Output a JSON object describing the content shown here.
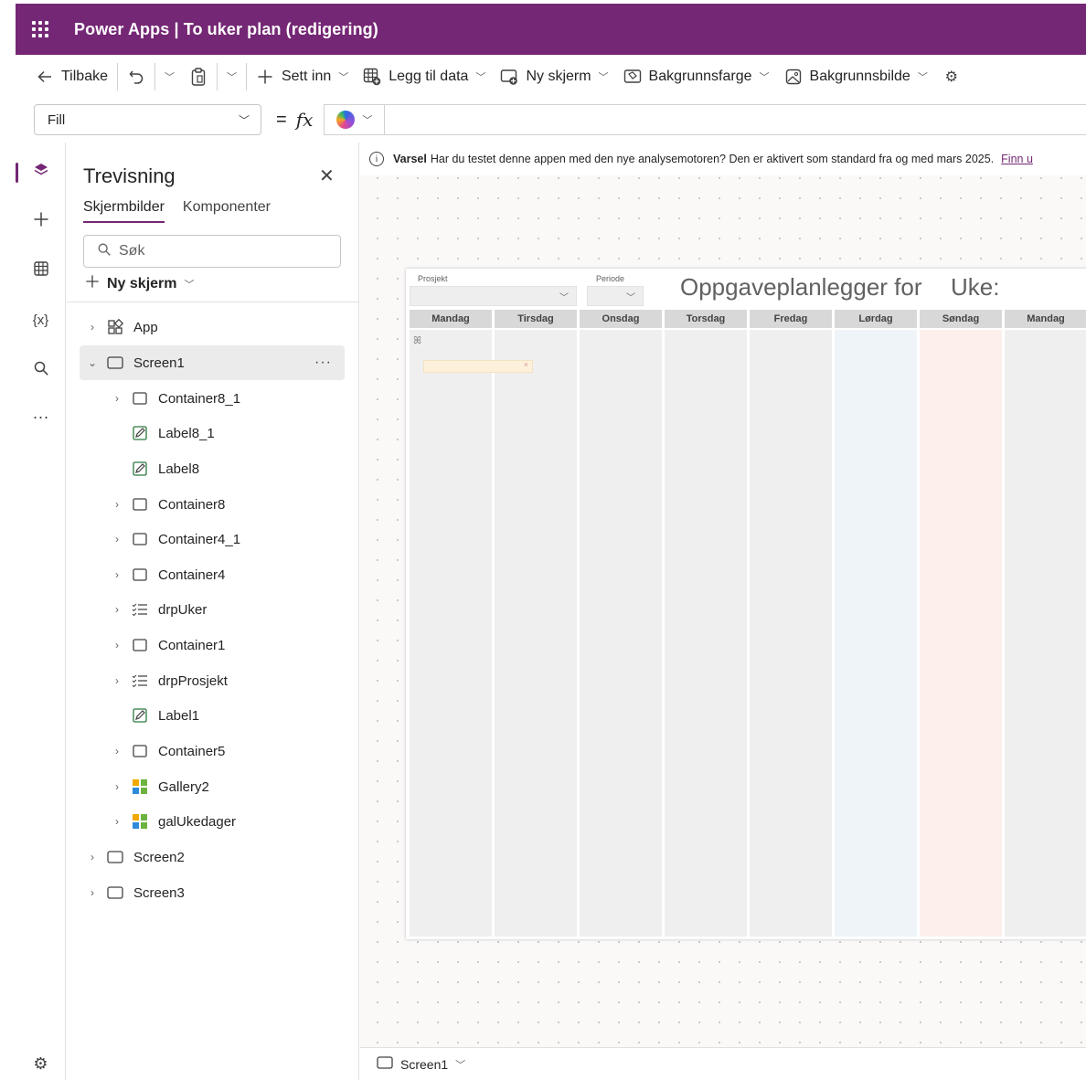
{
  "app": {
    "title": "Power Apps  |  To uker plan (redigering)"
  },
  "commandbar": {
    "back": "Tilbake",
    "insert": "Sett inn",
    "add_data": "Legg til data",
    "new_screen": "Ny skjerm",
    "background_color": "Bakgrunnsfarge",
    "background_image": "Bakgrunnsbilde"
  },
  "formulabar": {
    "property": "Fill",
    "equals": "=",
    "fx": "fx",
    "formula": ""
  },
  "tree": {
    "title": "Trevisning",
    "tabs": [
      "Skjermbilder",
      "Komponenter"
    ],
    "search_placeholder": "Søk",
    "new_screen": "Ny skjerm",
    "nodes": [
      {
        "label": "App",
        "icon": "app-icon"
      },
      {
        "label": "Screen1",
        "icon": "screen-icon"
      },
      {
        "label": "Container8_1",
        "icon": "container-icon"
      },
      {
        "label": "Label8_1",
        "icon": "label-icon"
      },
      {
        "label": "Label8",
        "icon": "label-icon"
      },
      {
        "label": "Container8",
        "icon": "container-icon"
      },
      {
        "label": "Container4_1",
        "icon": "container-icon"
      },
      {
        "label": "Container4",
        "icon": "container-icon"
      },
      {
        "label": "drpUker",
        "icon": "dropdown-icon"
      },
      {
        "label": "Container1",
        "icon": "container-icon"
      },
      {
        "label": "drpProsjekt",
        "icon": "dropdown-icon"
      },
      {
        "label": "Label1",
        "icon": "label-icon"
      },
      {
        "label": "Container5",
        "icon": "container-icon"
      },
      {
        "label": "Gallery2",
        "icon": "gallery-icon"
      },
      {
        "label": "galUkedager",
        "icon": "gallery-icon"
      },
      {
        "label": "Screen2",
        "icon": "screen-icon"
      },
      {
        "label": "Screen3",
        "icon": "screen-icon"
      }
    ]
  },
  "banner": {
    "label": "Varsel",
    "text": "Har du testet denne appen med den nye analysemotoren? Den er aktivert som standard fra og med mars 2025.",
    "link": "Finn u"
  },
  "app_screen": {
    "project_label": "Prosjekt",
    "period_label": "Periode",
    "heading": "Oppgaveplanlegger for",
    "week_label": "Uke:",
    "days": [
      "Mandag",
      "Tirsdag",
      "Onsdag",
      "Torsdag",
      "Fredag",
      "Lørdag",
      "Søndag",
      "Mandag"
    ]
  },
  "statusbar": {
    "screen": "Screen1"
  },
  "colors": {
    "brand": "#742774",
    "saturday": "#eef4f8",
    "sunday": "#fcefec"
  }
}
